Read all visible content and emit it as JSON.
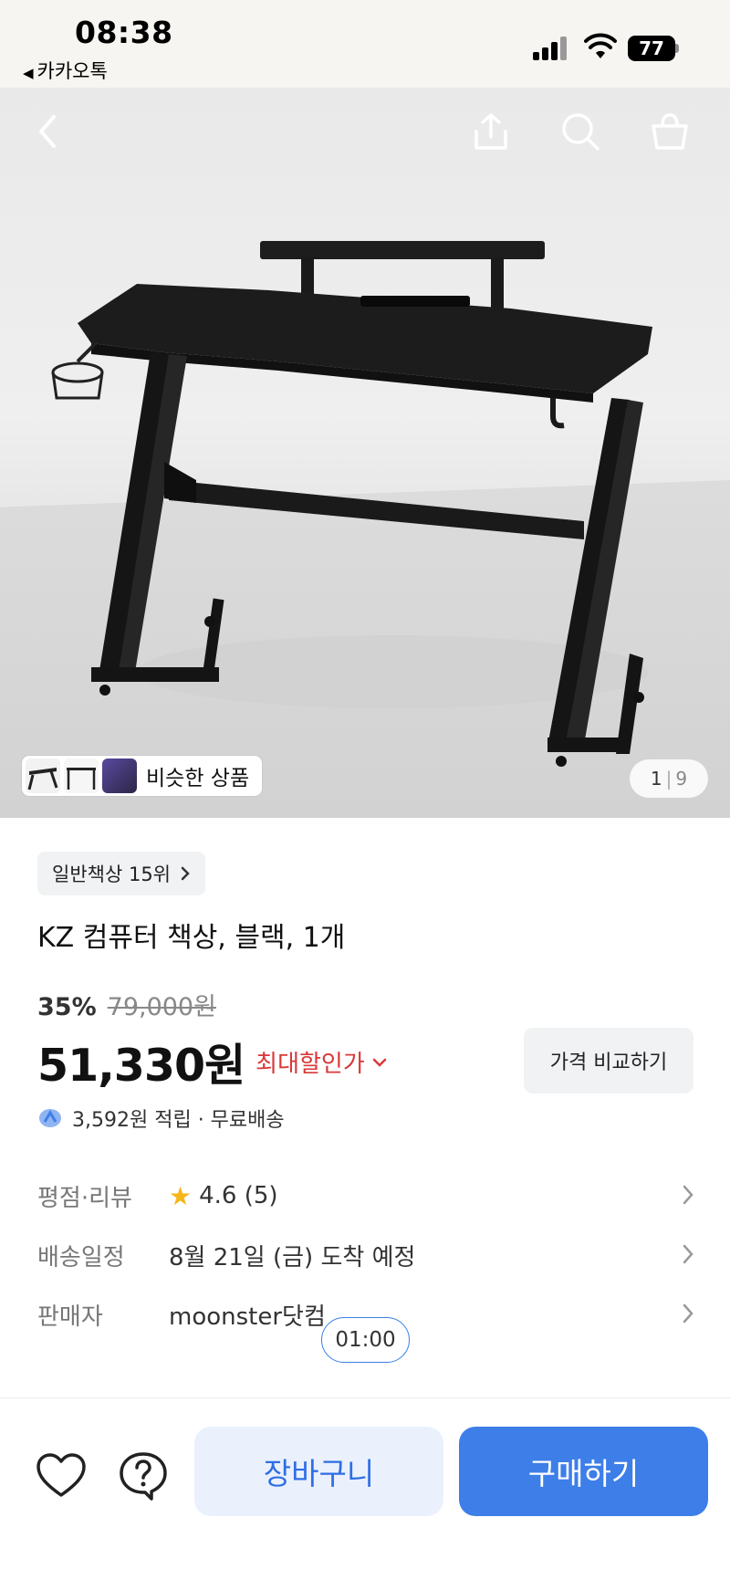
{
  "status_bar": {
    "time": "08:38",
    "back_app": "카카오톡",
    "battery": "77"
  },
  "hero": {
    "similar_label": "비슷한 상품",
    "page_current": "1",
    "page_total": "9"
  },
  "product": {
    "rank_badge": "일반책상 15위",
    "title": "KZ 컴퓨터 책상, 블랙, 1개",
    "discount_rate": "35%",
    "original_price": "79,000원",
    "sale_price": "51,330원",
    "max_discount_label": "최대할인가",
    "compare_button": "가격 비교하기",
    "points_text": "3,592원 적립 · 무료배송"
  },
  "info": {
    "rating_key": "평점·리뷰",
    "rating_value": "4.6 (5)",
    "delivery_key": "배송일정",
    "delivery_value": "8월 21일 (금) 도착 예정",
    "seller_key": "판매자",
    "seller_value": "moonster닷컴"
  },
  "timer": "01:00",
  "bottom_bar": {
    "cart_label": "장바구니",
    "buy_label": "구매하기"
  },
  "colors": {
    "accent": "#3d7ee9",
    "sale_red": "#d93838",
    "star": "#f6b619"
  }
}
